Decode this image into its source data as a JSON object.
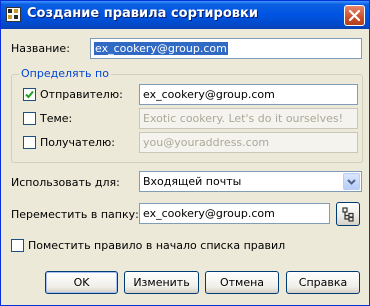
{
  "window": {
    "title": "Создание правила сортировки"
  },
  "name_field": {
    "label": "Название:",
    "value": "ex_cookery@group.com"
  },
  "determine_group": {
    "legend": "Определять по",
    "sender": {
      "label": "Отправителю:",
      "checked": true,
      "value": "ex_cookery@group.com"
    },
    "subject": {
      "label": "Теме:",
      "checked": false,
      "value": "Exotic cookery. Let's do it ourselves!"
    },
    "recipient": {
      "label": "Получателю:",
      "checked": false,
      "value": "you@youraddress.com"
    }
  },
  "use_for": {
    "label": "Использовать для:",
    "selected": "Входящей почты"
  },
  "move_to": {
    "label": "Переместить в папку:",
    "value": "ex_cookery@group.com"
  },
  "place_at_top": {
    "label": "Поместить правило в начало списка правил",
    "checked": false
  },
  "buttons": {
    "ok": "OK",
    "edit": "Изменить",
    "cancel": "Отмена",
    "help": "Справка"
  },
  "colors": {
    "titlebar": "#0054e3",
    "dialog_bg": "#ece9d8",
    "selection": "#316ac5",
    "legend_text": "#0046d5"
  }
}
